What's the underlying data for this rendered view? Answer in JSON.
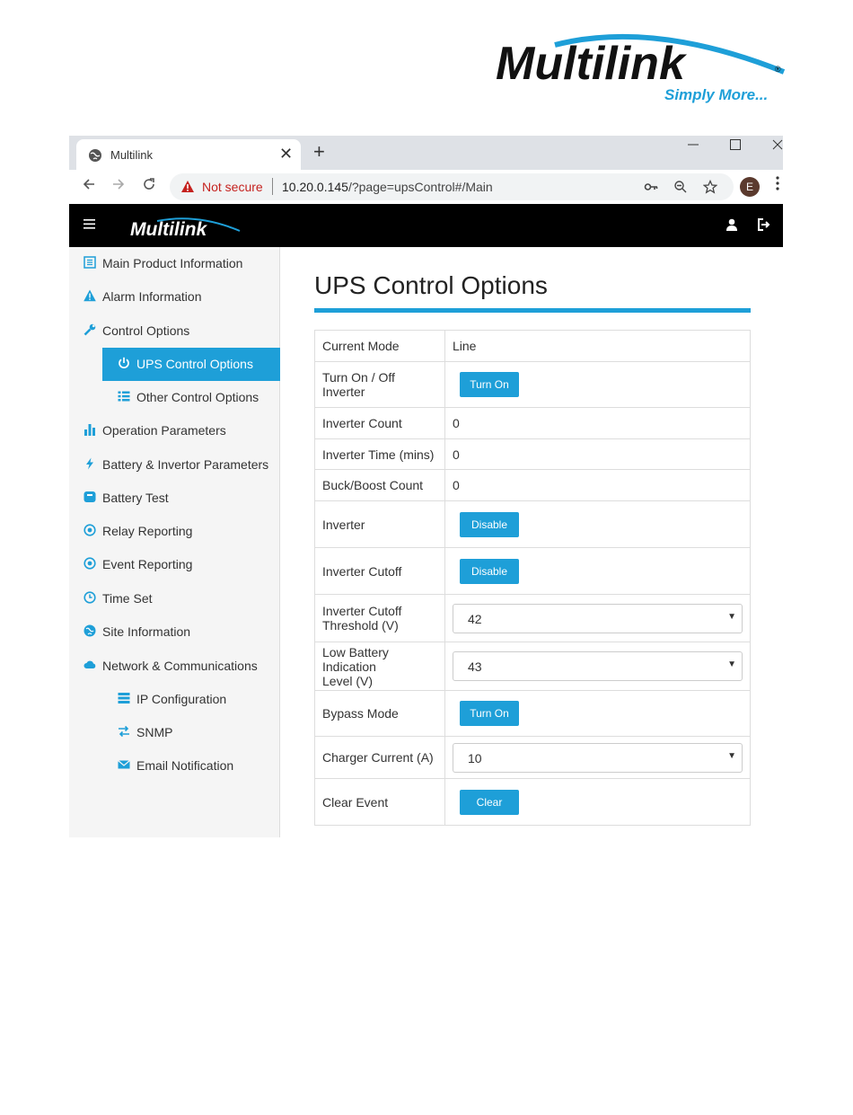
{
  "brand": {
    "name": "Multilink",
    "tagline": "Simply More..."
  },
  "browser": {
    "tab_title": "Multilink",
    "new_tab_label": "+",
    "close_tab_label": "✕",
    "security_label": "Not secure",
    "url_host": "10.20.0.145",
    "url_path": "/?page=upsControl#/Main",
    "profile_initial": "E"
  },
  "app": {
    "logo_text": "Multilink"
  },
  "sidebar": {
    "items": [
      {
        "label": "Main Product Information",
        "icon": "list-icon"
      },
      {
        "label": "Alarm Information",
        "icon": "warning-icon"
      },
      {
        "label": "Control Options",
        "icon": "wrench-icon"
      },
      {
        "label": "UPS Control Options",
        "icon": "power-icon",
        "active": true
      },
      {
        "label": "Other Control Options",
        "icon": "list-bullets-icon"
      },
      {
        "label": "Operation Parameters",
        "icon": "bar-chart-icon"
      },
      {
        "label": "Battery & Invertor Parameters",
        "icon": "bolt-icon"
      },
      {
        "label": "Battery Test",
        "icon": "battery-test-icon"
      },
      {
        "label": "Relay Reporting",
        "icon": "target-icon"
      },
      {
        "label": "Event Reporting",
        "icon": "target-icon"
      },
      {
        "label": "Time Set",
        "icon": "clock-icon"
      },
      {
        "label": "Site Information",
        "icon": "globe-icon"
      },
      {
        "label": "Network & Communications",
        "icon": "cloud-icon"
      },
      {
        "label": "IP Configuration",
        "icon": "server-icon"
      },
      {
        "label": "SNMP",
        "icon": "exchange-icon"
      },
      {
        "label": "Email Notification",
        "icon": "envelope-icon"
      }
    ]
  },
  "main": {
    "title": "UPS Control Options",
    "rows": [
      {
        "label": "Current Mode",
        "value": "Line"
      },
      {
        "label": "Turn On / Off Inverter",
        "button": "Turn On"
      },
      {
        "label": "Inverter Count",
        "value": "0"
      },
      {
        "label": "Inverter Time (mins)",
        "value": "0"
      },
      {
        "label": "Buck/Boost Count",
        "value": "0"
      },
      {
        "label": "Inverter",
        "button": "Disable"
      },
      {
        "label": "Inverter Cutoff",
        "button": "Disable"
      },
      {
        "label_line1": "Inverter Cutoff",
        "label_line2": "Threshold (V)",
        "select": "42"
      },
      {
        "label_line1": "Low Battery Indication",
        "label_line2": "Level (V)",
        "select": "43"
      },
      {
        "label": "Bypass Mode",
        "button": "Turn On"
      },
      {
        "label": "Charger Current (A)",
        "select": "10"
      },
      {
        "label": "Clear Event",
        "button": "Clear"
      }
    ]
  },
  "colors": {
    "accent": "#1e9fd8",
    "appbar": "#000000",
    "sidebar_bg": "#f5f5f5",
    "warning": "#c5221f"
  }
}
